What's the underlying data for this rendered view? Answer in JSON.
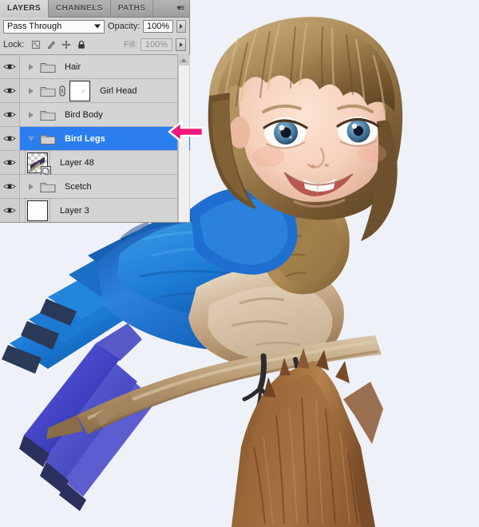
{
  "app": {
    "panel_title": "Layers"
  },
  "tabs": [
    {
      "label": "LAYERS",
      "active": true
    },
    {
      "label": "CHANNELS",
      "active": false
    },
    {
      "label": "PATHS",
      "active": false
    }
  ],
  "panel_menu": {
    "icon": "panel-menu-icon",
    "glyph": "▾≡"
  },
  "controls": {
    "blend_mode": "Pass Through",
    "blend_mode_placeholder": "Pass Through",
    "opacity_label": "Opacity:",
    "opacity_value": "100%",
    "lock_label": "Lock:",
    "fill_label": "Fill:",
    "fill_value": "100%",
    "lock_icons": [
      "lock-transparent-pixels-icon",
      "lock-image-pixels-icon",
      "lock-position-icon",
      "lock-all-icon"
    ]
  },
  "layers": [
    {
      "name": "Hair",
      "kind": "group",
      "visible": true,
      "expanded": false,
      "selected": false,
      "has_link": false,
      "thumb": "none"
    },
    {
      "name": "Girl Head",
      "kind": "group",
      "visible": true,
      "expanded": false,
      "selected": false,
      "has_link": true,
      "thumb": "mask"
    },
    {
      "name": "Bird Body",
      "kind": "group",
      "visible": true,
      "expanded": false,
      "selected": false,
      "has_link": false,
      "thumb": "none"
    },
    {
      "name": "Bird Legs",
      "kind": "group",
      "visible": true,
      "expanded": true,
      "selected": true,
      "has_link": false,
      "thumb": "none"
    },
    {
      "name": "Layer 48",
      "kind": "pixel",
      "visible": true,
      "expanded": false,
      "selected": false,
      "has_link": false,
      "thumb": "checker",
      "badge": "smart-object-badge"
    },
    {
      "name": "Scetch",
      "kind": "group",
      "visible": true,
      "expanded": false,
      "selected": false,
      "has_link": false,
      "thumb": "none"
    },
    {
      "name": "Layer 3",
      "kind": "pixel",
      "visible": true,
      "expanded": false,
      "selected": false,
      "has_link": false,
      "thumb": "blank"
    }
  ],
  "scrollbar": {
    "name": "layers-vertical-scrollbar",
    "up_arrow": "scroll-up-arrow"
  },
  "annotation": {
    "arrow_name": "pink-pointer-arrow",
    "points_at": "Bird Legs",
    "color": "#f0187c",
    "outline": "#ffffff"
  },
  "artwork": {
    "title": "Bird with girl head photo manipulation",
    "background_color": "#eef1f7",
    "subject": "bluebird perched on a branch with a child's head composited",
    "palette": {
      "sky": "#eef1f7",
      "wing_blue": "#1f6fd0",
      "wing_blue_light": "#3a9ae8",
      "tail_violet": "#4d4fd0",
      "breast_tan": "#c8ab86",
      "branch_brown": "#a88a62",
      "trunk_brown": "#8a5a33",
      "hair_blonde": "#b59460",
      "hair_dark": "#6d512c",
      "skin": "#f4d6c4",
      "eye_blue": "#4f7fa3"
    }
  }
}
